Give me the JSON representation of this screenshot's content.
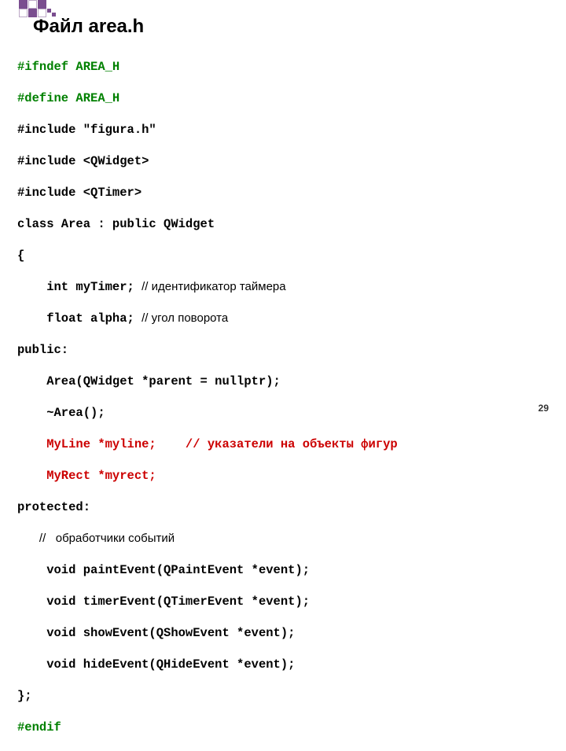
{
  "title": "Файл area.h",
  "code": {
    "l1": "#ifndef AREA_H",
    "l2": "#define AREA_H",
    "l3": "#include \"figura.h\"",
    "l4": "#include <QWidget>",
    "l5": "#include <QTimer>",
    "l6": "class Area : public QWidget",
    "l7": "{",
    "l8a": "    int myTimer; ",
    "l8b": "// идентификатор таймера",
    "l9a": "    float alpha; ",
    "l9b": "// угол поворота",
    "l10": "public:",
    "l11": "    Area(QWidget *parent = nullptr);",
    "l12": "    ~Area();",
    "l13": "    MyLine *myline;    // указатели на объекты фигур",
    "l14": "    MyRect *myrect;",
    "l15": "protected:",
    "l16a": "   ",
    "l16b": "//   обработчики событий",
    "l17": "    void paintEvent(QPaintEvent *event);",
    "l18": "    void timerEvent(QTimerEvent *event);",
    "l19": "    void showEvent(QShowEvent *event);",
    "l20": "    void hideEvent(QHideEvent *event);",
    "l21": "};",
    "l22": "#endif"
  },
  "pagenum": "29"
}
